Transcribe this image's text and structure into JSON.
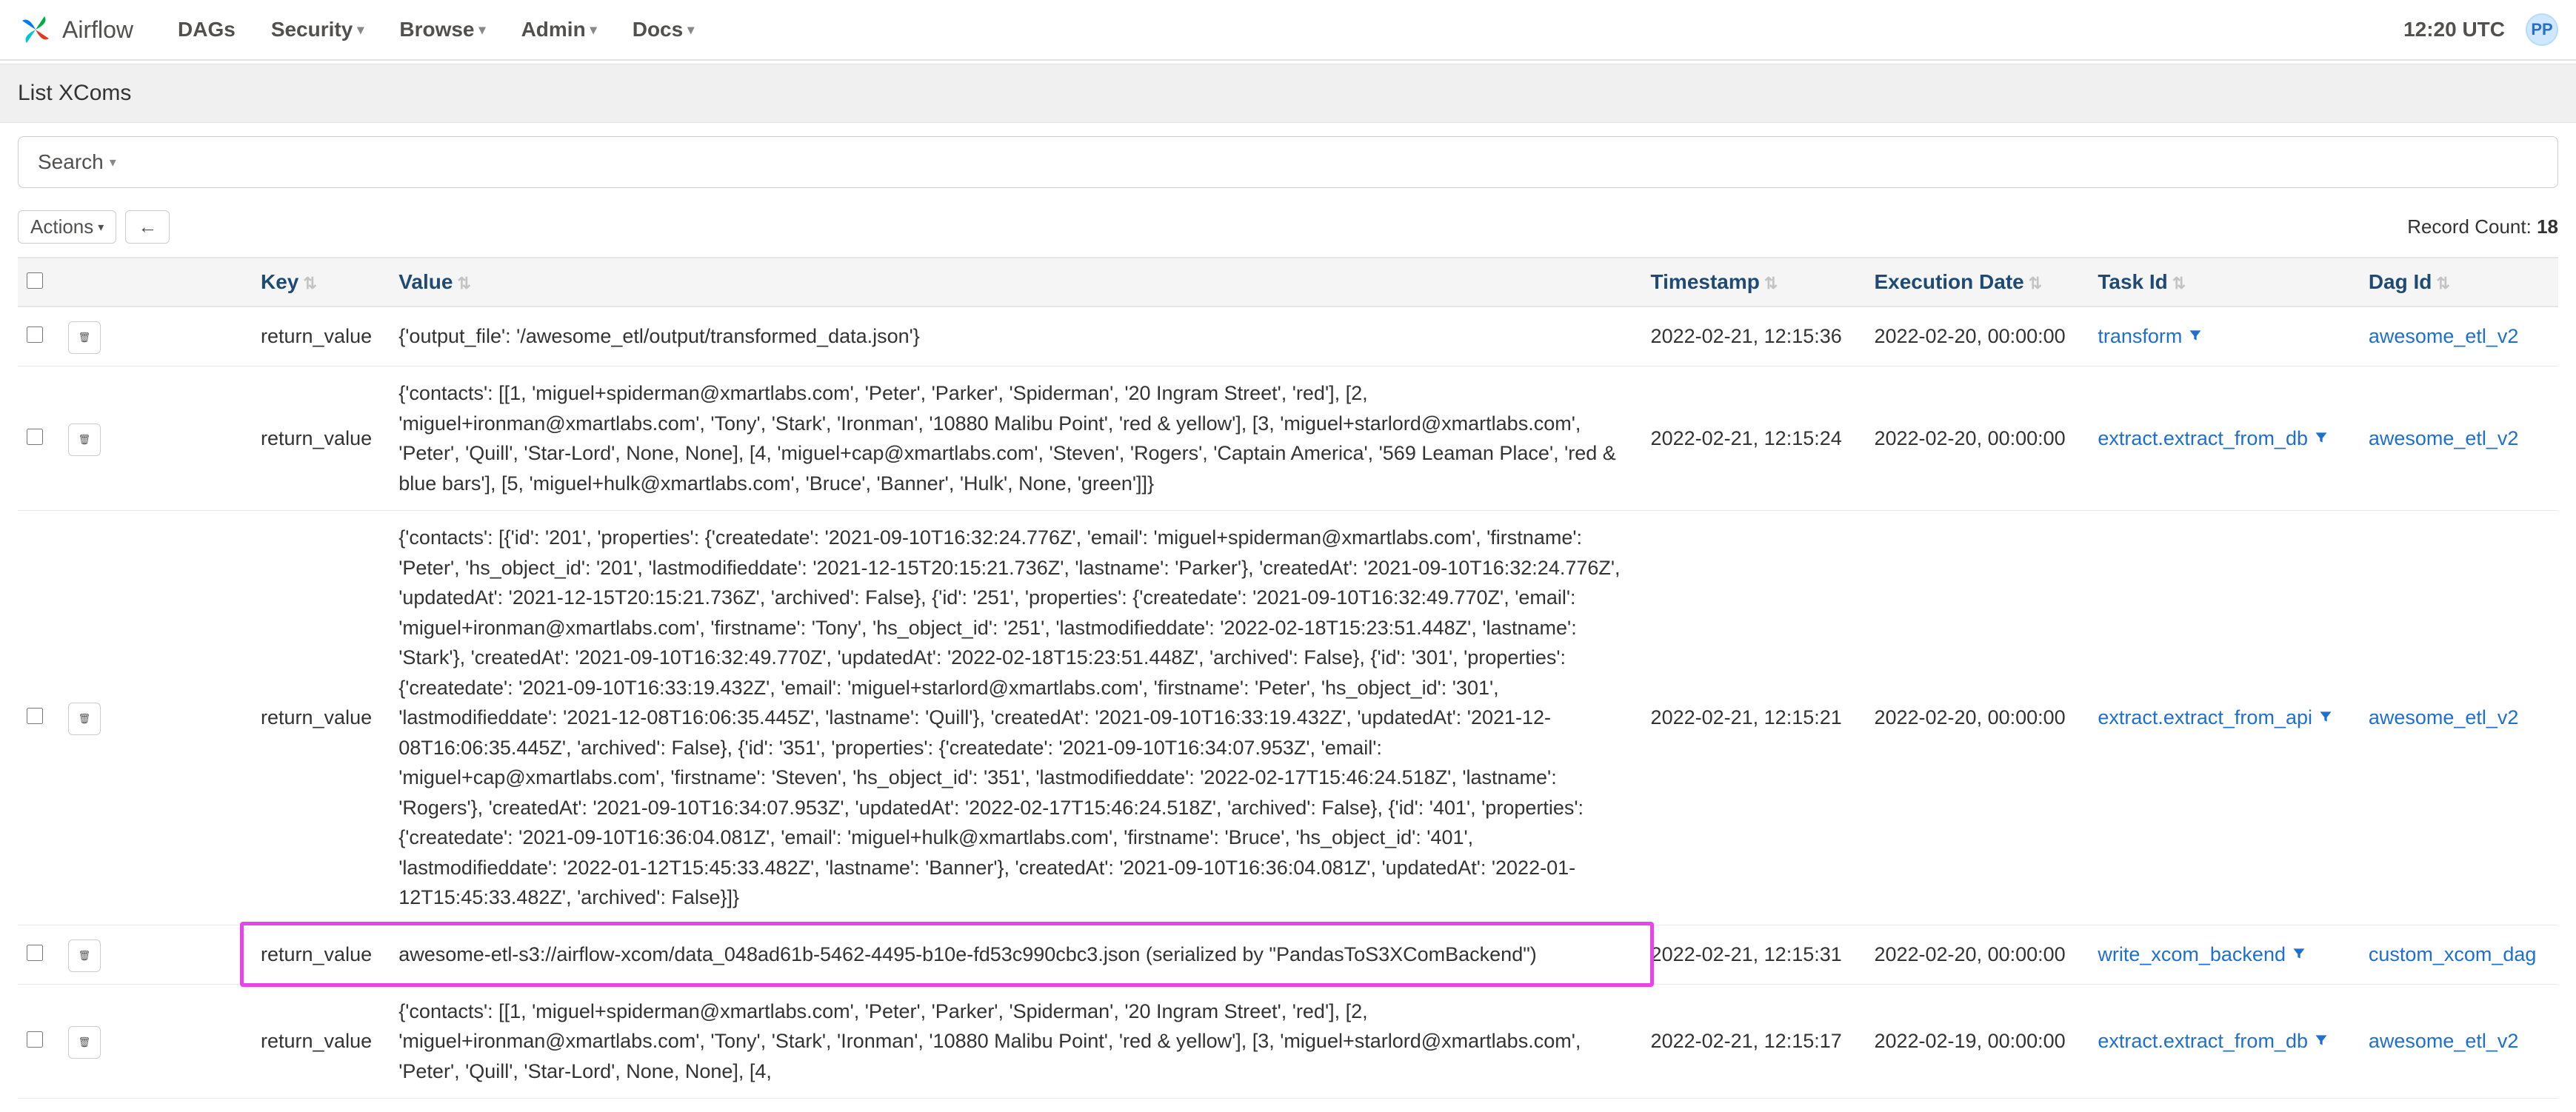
{
  "nav": {
    "brand": "Airflow",
    "items": [
      "DAGs",
      "Security",
      "Browse",
      "Admin",
      "Docs"
    ],
    "has_caret": [
      false,
      true,
      true,
      true,
      true
    ],
    "time": "12:20 UTC",
    "avatar": "PP"
  },
  "page_title": "List XComs",
  "search_label": "Search",
  "actions_label": "Actions",
  "back_arrow": "←",
  "record_count_label": "Record Count:",
  "record_count_value": "18",
  "columns": [
    "",
    "",
    "Key",
    "Value",
    "Timestamp",
    "Execution Date",
    "Task Id",
    "Dag Id"
  ],
  "rows": [
    {
      "key": "return_value",
      "value": "{'output_file': '/awesome_etl/output/transformed_data.json'}",
      "timestamp": "2022-02-21, 12:15:36",
      "execution_date": "2022-02-20, 00:00:00",
      "task_id": "transform",
      "task_filter": true,
      "dag_id": "awesome_etl_v2"
    },
    {
      "key": "return_value",
      "value": "{'contacts': [[1, 'miguel+spiderman@xmartlabs.com', 'Peter', 'Parker', 'Spiderman', '20 Ingram Street', 'red'], [2, 'miguel+ironman@xmartlabs.com', 'Tony', 'Stark', 'Ironman', '10880 Malibu Point', 'red & yellow'], [3, 'miguel+starlord@xmartlabs.com', 'Peter', 'Quill', 'Star-Lord', None, None], [4, 'miguel+cap@xmartlabs.com', 'Steven', 'Rogers', 'Captain America', '569 Leaman Place', 'red & blue bars'], [5, 'miguel+hulk@xmartlabs.com', 'Bruce', 'Banner', 'Hulk', None, 'green']]}",
      "timestamp": "2022-02-21, 12:15:24",
      "execution_date": "2022-02-20, 00:00:00",
      "task_id": "extract.extract_from_db",
      "task_filter": true,
      "dag_id": "awesome_etl_v2"
    },
    {
      "key": "return_value",
      "value": "{'contacts': [{'id': '201', 'properties': {'createdate': '2021-09-10T16:32:24.776Z', 'email': 'miguel+spiderman@xmartlabs.com', 'firstname': 'Peter', 'hs_object_id': '201', 'lastmodifieddate': '2021-12-15T20:15:21.736Z', 'lastname': 'Parker'}, 'createdAt': '2021-09-10T16:32:24.776Z', 'updatedAt': '2021-12-15T20:15:21.736Z', 'archived': False}, {'id': '251', 'properties': {'createdate': '2021-09-10T16:32:49.770Z', 'email': 'miguel+ironman@xmartlabs.com', 'firstname': 'Tony', 'hs_object_id': '251', 'lastmodifieddate': '2022-02-18T15:23:51.448Z', 'lastname': 'Stark'}, 'createdAt': '2021-09-10T16:32:49.770Z', 'updatedAt': '2022-02-18T15:23:51.448Z', 'archived': False}, {'id': '301', 'properties': {'createdate': '2021-09-10T16:33:19.432Z', 'email': 'miguel+starlord@xmartlabs.com', 'firstname': 'Peter', 'hs_object_id': '301', 'lastmodifieddate': '2021-12-08T16:06:35.445Z', 'lastname': 'Quill'}, 'createdAt': '2021-09-10T16:33:19.432Z', 'updatedAt': '2021-12-08T16:06:35.445Z', 'archived': False}, {'id': '351', 'properties': {'createdate': '2021-09-10T16:34:07.953Z', 'email': 'miguel+cap@xmartlabs.com', 'firstname': 'Steven', 'hs_object_id': '351', 'lastmodifieddate': '2022-02-17T15:46:24.518Z', 'lastname': 'Rogers'}, 'createdAt': '2021-09-10T16:34:07.953Z', 'updatedAt': '2022-02-17T15:46:24.518Z', 'archived': False}, {'id': '401', 'properties': {'createdate': '2021-09-10T16:36:04.081Z', 'email': 'miguel+hulk@xmartlabs.com', 'firstname': 'Bruce', 'hs_object_id': '401', 'lastmodifieddate': '2022-01-12T15:45:33.482Z', 'lastname': 'Banner'}, 'createdAt': '2021-09-10T16:36:04.081Z', 'updatedAt': '2022-01-12T15:45:33.482Z', 'archived': False}]}",
      "timestamp": "2022-02-21, 12:15:21",
      "execution_date": "2022-02-20, 00:00:00",
      "task_id": "extract.extract_from_api",
      "task_filter": true,
      "dag_id": "awesome_etl_v2"
    },
    {
      "key": "return_value",
      "value": "awesome-etl-s3://airflow-xcom/data_048ad61b-5462-4495-b10e-fd53c990cbc3.json (serialized by \"PandasToS3XComBackend\")",
      "timestamp": "2022-02-21, 12:15:31",
      "execution_date": "2022-02-20, 00:00:00",
      "task_id": "write_xcom_backend",
      "task_filter": true,
      "dag_id": "custom_xcom_dag",
      "highlighted": true
    },
    {
      "key": "return_value",
      "value": "{'contacts': [[1, 'miguel+spiderman@xmartlabs.com', 'Peter', 'Parker', 'Spiderman', '20 Ingram Street', 'red'], [2, 'miguel+ironman@xmartlabs.com', 'Tony', 'Stark', 'Ironman', '10880 Malibu Point', 'red & yellow'], [3, 'miguel+starlord@xmartlabs.com', 'Peter', 'Quill', 'Star-Lord', None, None], [4,",
      "timestamp": "2022-02-21, 12:15:17",
      "execution_date": "2022-02-19, 00:00:00",
      "task_id": "extract.extract_from_db",
      "task_filter": true,
      "dag_id": "awesome_etl_v2",
      "partial": true
    }
  ]
}
